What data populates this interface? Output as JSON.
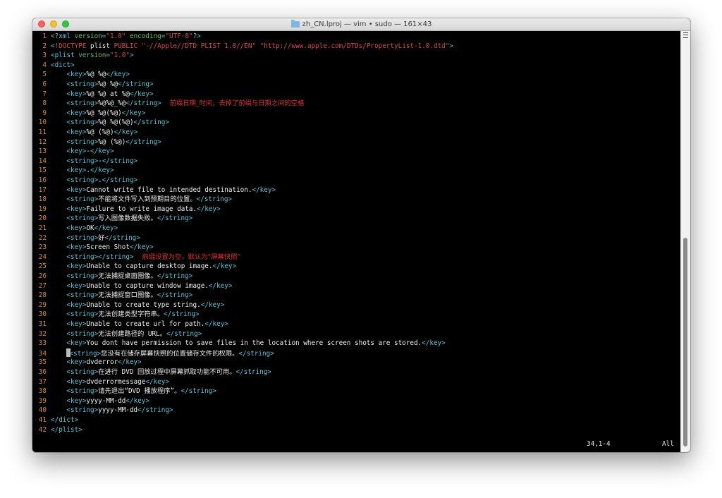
{
  "window": {
    "title": "zh_CN.lproj — vim • sudo — 161×43"
  },
  "lines": [
    {
      "n": "1",
      "tokens": [
        [
          "tag",
          "<?"
        ],
        [
          "tag",
          "xml"
        ],
        [
          "attr",
          " version"
        ],
        [
          "tag",
          "="
        ],
        [
          "str",
          "\"1.0\""
        ],
        [
          "attr",
          " encoding"
        ],
        [
          "tag",
          "="
        ],
        [
          "str",
          "\"UTF-8\""
        ],
        [
          "tag",
          "?>"
        ]
      ]
    },
    {
      "n": "2",
      "tokens": [
        [
          "tag",
          "<"
        ],
        [
          "bang",
          "!DOCTYPE"
        ],
        [
          "kw",
          " plist"
        ],
        [
          "str",
          " PUBLIC"
        ],
        [
          "str",
          " \"-//Apple//DTD PLIST 1.0//EN\""
        ],
        [
          "str",
          " \"http://www.apple.com/DTDs/PropertyList-1.0.dtd\""
        ],
        [
          "tag",
          ">"
        ]
      ]
    },
    {
      "n": "3",
      "tokens": [
        [
          "tag",
          "<plist"
        ],
        [
          "attr",
          " version"
        ],
        [
          "tag",
          "="
        ],
        [
          "str",
          "\"1.0\""
        ],
        [
          "tag",
          ">"
        ]
      ]
    },
    {
      "n": "4",
      "tokens": [
        [
          "tag",
          "<dict>"
        ]
      ]
    },
    {
      "n": "5",
      "tokens": [
        [
          "kw",
          "    "
        ],
        [
          "tag",
          "<key>"
        ],
        [
          "txt",
          "%@ %@"
        ],
        [
          "tag",
          "</key>"
        ]
      ]
    },
    {
      "n": "6",
      "tokens": [
        [
          "kw",
          "    "
        ],
        [
          "tag",
          "<string>"
        ],
        [
          "txt",
          "%@ %@"
        ],
        [
          "tag",
          "</string>"
        ]
      ]
    },
    {
      "n": "7",
      "tokens": [
        [
          "kw",
          "    "
        ],
        [
          "tag",
          "<key>"
        ],
        [
          "txt",
          "%@ %@ at %@"
        ],
        [
          "tag",
          "</key>"
        ]
      ]
    },
    {
      "n": "8",
      "tokens": [
        [
          "kw",
          "    "
        ],
        [
          "tag",
          "<string>"
        ],
        [
          "txt",
          "%@%@_%@"
        ],
        [
          "tag",
          "</string>"
        ]
      ],
      "note": "前缀日期_时间，去掉了前缀与日期之间的空格"
    },
    {
      "n": "9",
      "tokens": [
        [
          "kw",
          "    "
        ],
        [
          "tag",
          "<key>"
        ],
        [
          "txt",
          "%@ %@(%@)"
        ],
        [
          "tag",
          "</key>"
        ]
      ]
    },
    {
      "n": "10",
      "tokens": [
        [
          "kw",
          "    "
        ],
        [
          "tag",
          "<string>"
        ],
        [
          "txt",
          "%@ %@(%@)"
        ],
        [
          "tag",
          "</string>"
        ]
      ]
    },
    {
      "n": "11",
      "tokens": [
        [
          "kw",
          "    "
        ],
        [
          "tag",
          "<key>"
        ],
        [
          "txt",
          "%@ (%@)"
        ],
        [
          "tag",
          "</key>"
        ]
      ]
    },
    {
      "n": "12",
      "tokens": [
        [
          "kw",
          "    "
        ],
        [
          "tag",
          "<string>"
        ],
        [
          "txt",
          "%@ (%@)"
        ],
        [
          "tag",
          "</string>"
        ]
      ]
    },
    {
      "n": "13",
      "tokens": [
        [
          "kw",
          "    "
        ],
        [
          "tag",
          "<key>"
        ],
        [
          "txt",
          "-"
        ],
        [
          "tag",
          "</key>"
        ]
      ]
    },
    {
      "n": "14",
      "tokens": [
        [
          "kw",
          "    "
        ],
        [
          "tag",
          "<string>"
        ],
        [
          "txt",
          "-"
        ],
        [
          "tag",
          "</string>"
        ]
      ]
    },
    {
      "n": "15",
      "tokens": [
        [
          "kw",
          "    "
        ],
        [
          "tag",
          "<key>"
        ],
        [
          "txt",
          "."
        ],
        [
          "tag",
          "</key>"
        ]
      ]
    },
    {
      "n": "16",
      "tokens": [
        [
          "kw",
          "    "
        ],
        [
          "tag",
          "<string>"
        ],
        [
          "txt",
          "."
        ],
        [
          "tag",
          "</string>"
        ]
      ]
    },
    {
      "n": "17",
      "tokens": [
        [
          "kw",
          "    "
        ],
        [
          "tag",
          "<key>"
        ],
        [
          "txt",
          "Cannot write file to intended destination."
        ],
        [
          "tag",
          "</key>"
        ]
      ]
    },
    {
      "n": "18",
      "tokens": [
        [
          "kw",
          "    "
        ],
        [
          "tag",
          "<string>"
        ],
        [
          "txt",
          "不能将文件写入到预期目的位置。"
        ],
        [
          "tag",
          "</string>"
        ]
      ]
    },
    {
      "n": "19",
      "tokens": [
        [
          "kw",
          "    "
        ],
        [
          "tag",
          "<key>"
        ],
        [
          "txt",
          "Failure to write image data."
        ],
        [
          "tag",
          "</key>"
        ]
      ]
    },
    {
      "n": "20",
      "tokens": [
        [
          "kw",
          "    "
        ],
        [
          "tag",
          "<string>"
        ],
        [
          "txt",
          "写入图像数据失败。"
        ],
        [
          "tag",
          "</string>"
        ]
      ]
    },
    {
      "n": "21",
      "tokens": [
        [
          "kw",
          "    "
        ],
        [
          "tag",
          "<key>"
        ],
        [
          "txt",
          "OK"
        ],
        [
          "tag",
          "</key>"
        ]
      ]
    },
    {
      "n": "22",
      "tokens": [
        [
          "kw",
          "    "
        ],
        [
          "tag",
          "<string>"
        ],
        [
          "txt",
          "好"
        ],
        [
          "tag",
          "</string>"
        ]
      ]
    },
    {
      "n": "23",
      "tokens": [
        [
          "kw",
          "    "
        ],
        [
          "tag",
          "<key>"
        ],
        [
          "txt",
          "Screen Shot"
        ],
        [
          "tag",
          "</key>"
        ]
      ]
    },
    {
      "n": "24",
      "tokens": [
        [
          "kw",
          "    "
        ],
        [
          "tag",
          "<string></string>"
        ]
      ],
      "note": "前缀设置为空，默认为“屏幕快照”"
    },
    {
      "n": "25",
      "tokens": [
        [
          "kw",
          "    "
        ],
        [
          "tag",
          "<key>"
        ],
        [
          "txt",
          "Unable to capture desktop image."
        ],
        [
          "tag",
          "</key>"
        ]
      ]
    },
    {
      "n": "26",
      "tokens": [
        [
          "kw",
          "    "
        ],
        [
          "tag",
          "<string>"
        ],
        [
          "txt",
          "无法捕捉桌面图像。"
        ],
        [
          "tag",
          "</string>"
        ]
      ]
    },
    {
      "n": "27",
      "tokens": [
        [
          "kw",
          "    "
        ],
        [
          "tag",
          "<key>"
        ],
        [
          "txt",
          "Unable to capture window image."
        ],
        [
          "tag",
          "</key>"
        ]
      ]
    },
    {
      "n": "28",
      "tokens": [
        [
          "kw",
          "    "
        ],
        [
          "tag",
          "<string>"
        ],
        [
          "txt",
          "无法捕捉窗口图像。"
        ],
        [
          "tag",
          "</string>"
        ]
      ]
    },
    {
      "n": "29",
      "tokens": [
        [
          "kw",
          "    "
        ],
        [
          "tag",
          "<key>"
        ],
        [
          "txt",
          "Unable to create type string."
        ],
        [
          "tag",
          "</key>"
        ]
      ]
    },
    {
      "n": "30",
      "tokens": [
        [
          "kw",
          "    "
        ],
        [
          "tag",
          "<string>"
        ],
        [
          "txt",
          "无法创建类型字符串。"
        ],
        [
          "tag",
          "</string>"
        ]
      ]
    },
    {
      "n": "31",
      "tokens": [
        [
          "kw",
          "    "
        ],
        [
          "tag",
          "<key>"
        ],
        [
          "txt",
          "Unable to create url for path."
        ],
        [
          "tag",
          "</key>"
        ]
      ]
    },
    {
      "n": "32",
      "tokens": [
        [
          "kw",
          "    "
        ],
        [
          "tag",
          "<string>"
        ],
        [
          "txt",
          "无法创建路径的 URL。"
        ],
        [
          "tag",
          "</string>"
        ]
      ]
    },
    {
      "n": "33",
      "tokens": [
        [
          "kw",
          "    "
        ],
        [
          "tag",
          "<key>"
        ],
        [
          "txt",
          "You dont have permission to save files in the location where screen shots are stored."
        ],
        [
          "tag",
          "</key>"
        ]
      ]
    },
    {
      "n": "34",
      "cursor": true,
      "tokens": [
        [
          "kw",
          "    "
        ],
        [
          "tag",
          "<string>"
        ],
        [
          "txt",
          "您没有在储存屏幕快照的位置储存文件的权限。"
        ],
        [
          "tag",
          "</string>"
        ]
      ]
    },
    {
      "n": "35",
      "tokens": [
        [
          "kw",
          "    "
        ],
        [
          "tag",
          "<key>"
        ],
        [
          "txt",
          "dvderror"
        ],
        [
          "tag",
          "</key>"
        ]
      ]
    },
    {
      "n": "36",
      "tokens": [
        [
          "kw",
          "    "
        ],
        [
          "tag",
          "<string>"
        ],
        [
          "txt",
          "在进行 DVD 回放过程中屏幕抓取功能不可用。"
        ],
        [
          "tag",
          "</string>"
        ]
      ]
    },
    {
      "n": "37",
      "tokens": [
        [
          "kw",
          "    "
        ],
        [
          "tag",
          "<key>"
        ],
        [
          "txt",
          "dvderrormessage"
        ],
        [
          "tag",
          "</key>"
        ]
      ]
    },
    {
      "n": "38",
      "tokens": [
        [
          "kw",
          "    "
        ],
        [
          "tag",
          "<string>"
        ],
        [
          "txt",
          "请先退出“DVD 播放程序”。"
        ],
        [
          "tag",
          "</string>"
        ]
      ]
    },
    {
      "n": "39",
      "tokens": [
        [
          "kw",
          "    "
        ],
        [
          "tag",
          "<key>"
        ],
        [
          "txt",
          "yyyy-MM-dd"
        ],
        [
          "tag",
          "</key>"
        ]
      ]
    },
    {
      "n": "40",
      "tokens": [
        [
          "kw",
          "    "
        ],
        [
          "tag",
          "<string>"
        ],
        [
          "txt",
          "yyyy-MM-dd"
        ],
        [
          "tag",
          "</string>"
        ]
      ]
    },
    {
      "n": "41",
      "tokens": [
        [
          "tag",
          "</dict>"
        ]
      ]
    },
    {
      "n": "42",
      "tokens": [
        [
          "tag",
          "</plist>"
        ]
      ]
    }
  ],
  "status": {
    "position": "34,1-4",
    "scroll": "All"
  },
  "colors": {
    "tag": "#5ec4d8",
    "attr": "#6ebf5a",
    "string": "#d84b4b",
    "line_number": "#d68d36",
    "note": "#e0322e"
  },
  "icons": {
    "title": "folder-icon",
    "scroll": "scroll-menu-icon"
  }
}
